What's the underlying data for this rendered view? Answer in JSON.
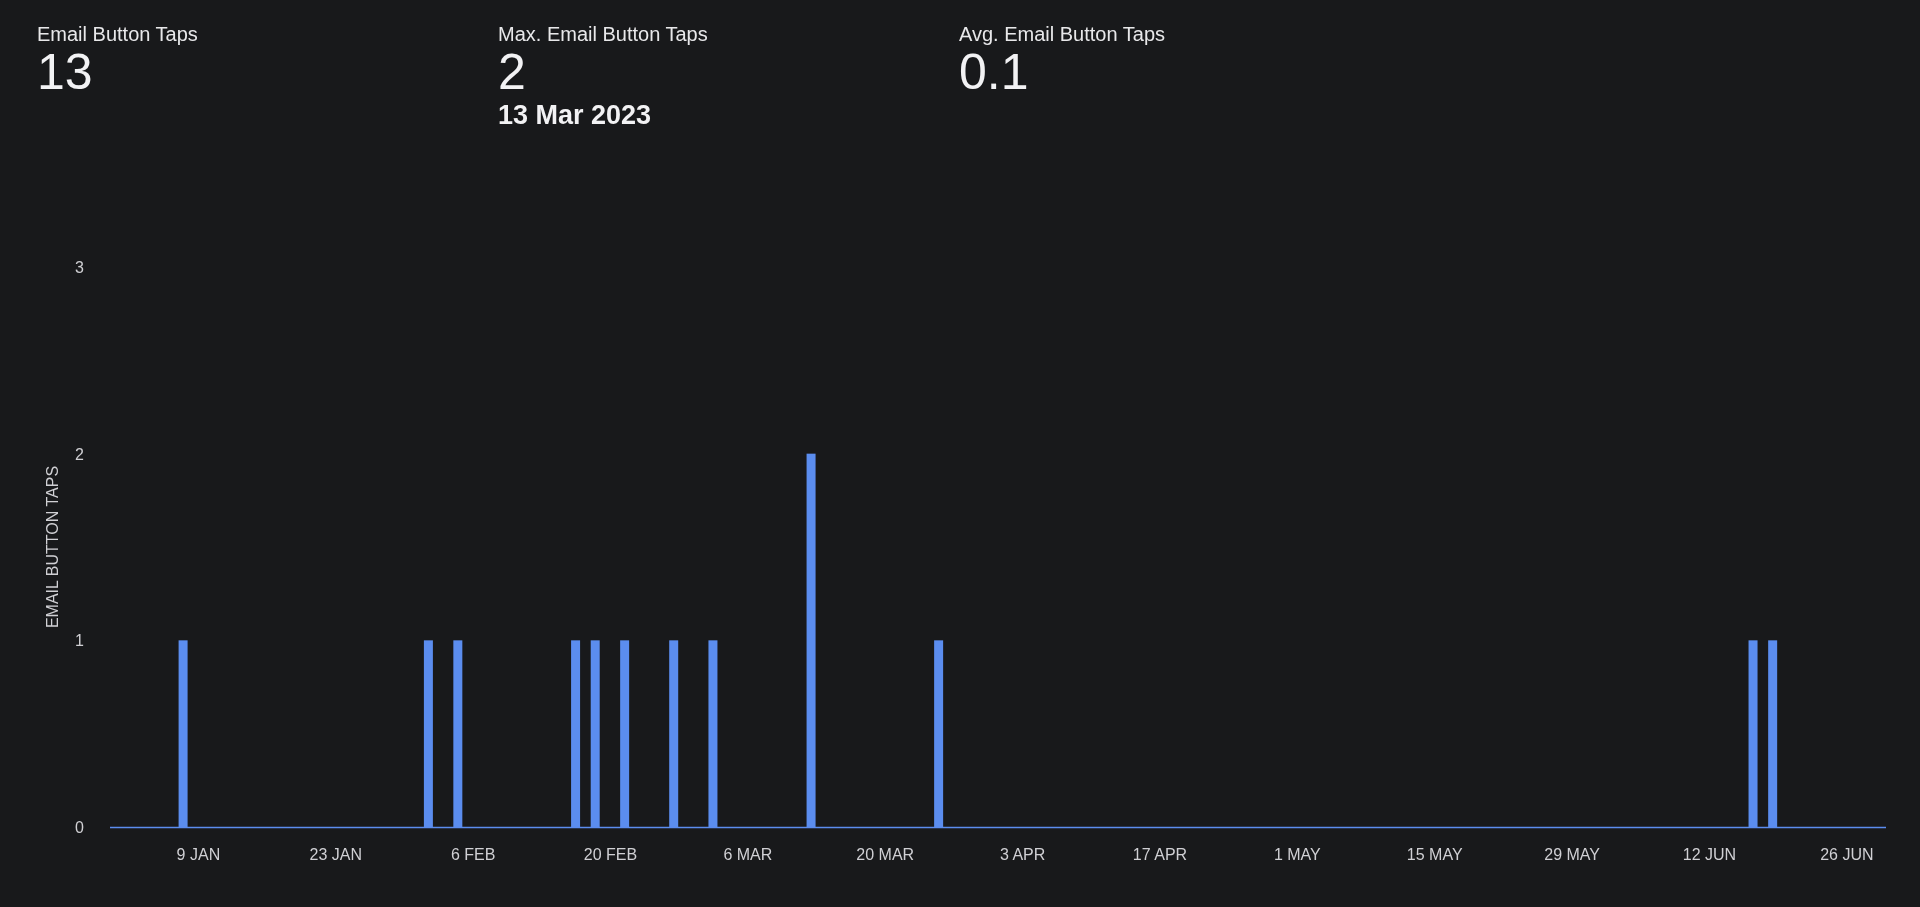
{
  "stats": [
    {
      "label": "Email Button Taps",
      "value": "13"
    },
    {
      "label": "Max. Email Button Taps",
      "value": "2",
      "date": "13 Mar 2023"
    },
    {
      "label": "Avg. Email Button Taps",
      "value": "0.1"
    }
  ],
  "chart_data": {
    "type": "bar",
    "ylabel": "EMAIL BUTTON TAPS",
    "categories": [
      null,
      null,
      null,
      null,
      null,
      null,
      null,
      null,
      "9 JAN",
      null,
      null,
      null,
      null,
      null,
      null,
      null,
      null,
      null,
      null,
      null,
      null,
      null,
      "23 JAN",
      null,
      null,
      null,
      null,
      null,
      null,
      null,
      null,
      null,
      null,
      null,
      null,
      null,
      "6 FEB",
      null,
      null,
      null,
      null,
      null,
      null,
      null,
      null,
      null,
      null,
      null,
      null,
      null,
      "20 FEB",
      null,
      null,
      null,
      null,
      null,
      null,
      null,
      null,
      null,
      null,
      null,
      null,
      null,
      "6 MAR",
      null,
      null,
      null,
      null,
      null,
      null,
      null,
      null,
      null,
      null,
      null,
      null,
      null,
      "20 MAR",
      null,
      null,
      null,
      null,
      null,
      null,
      null,
      null,
      null,
      null,
      null,
      null,
      null,
      "3 APR",
      null,
      null,
      null,
      null,
      null,
      null,
      null,
      null,
      null,
      null,
      null,
      null,
      null,
      "17 APR",
      null,
      null,
      null,
      null,
      null,
      null,
      null,
      null,
      null,
      null,
      null,
      null,
      null,
      "1 MAY",
      null,
      null,
      null,
      null,
      null,
      null,
      null,
      null,
      null,
      null,
      null,
      null,
      null,
      "15 MAY",
      null,
      null,
      null,
      null,
      null,
      null,
      null,
      null,
      null,
      null,
      null,
      null,
      null,
      "29 MAY",
      null,
      null,
      null,
      null,
      null,
      null,
      null,
      null,
      null,
      null,
      null,
      null,
      null,
      "12 JUN",
      null,
      null,
      null,
      null,
      null,
      null,
      null,
      null,
      null,
      null,
      null,
      null,
      null,
      "26 JUN",
      null,
      null,
      null,
      null
    ],
    "series": [
      {
        "color": "#5b8def",
        "values": [
          0,
          0,
          0,
          0,
          0,
          0,
          0,
          1,
          0,
          0,
          0,
          0,
          0,
          0,
          0,
          0,
          0,
          0,
          0,
          0,
          0,
          0,
          0,
          0,
          0,
          0,
          0,
          0,
          0,
          0,
          0,
          0,
          1,
          0,
          0,
          1,
          0,
          0,
          0,
          0,
          0,
          0,
          0,
          0,
          0,
          0,
          0,
          1,
          0,
          1,
          0,
          0,
          1,
          0,
          0,
          0,
          0,
          1,
          0,
          0,
          0,
          1,
          0,
          0,
          0,
          0,
          0,
          0,
          0,
          0,
          0,
          2,
          0,
          0,
          0,
          0,
          0,
          0,
          0,
          0,
          0,
          0,
          0,
          0,
          1,
          0,
          0,
          0,
          0,
          0,
          0,
          0,
          0,
          0,
          0,
          0,
          0,
          0,
          0,
          0,
          0,
          0,
          0,
          0,
          0,
          0,
          0,
          0,
          0,
          0,
          0,
          0,
          0,
          0,
          0,
          0,
          0,
          0,
          0,
          0,
          0,
          0,
          0,
          0,
          0,
          0,
          0,
          0,
          0,
          0,
          0,
          0,
          0,
          0,
          0,
          0,
          0,
          0,
          0,
          0,
          0,
          0,
          0,
          0,
          0,
          0,
          0,
          0,
          0,
          0,
          0,
          0,
          0,
          0,
          0,
          0,
          0,
          0,
          0,
          0,
          0,
          0,
          0,
          0,
          0,
          0,
          0,
          1,
          0,
          1,
          0,
          0,
          0,
          0,
          0,
          0,
          0,
          0,
          0,
          0,
          0
        ]
      }
    ],
    "ylim": [
      0,
      3
    ],
    "yticks": [
      0,
      1,
      2,
      3
    ]
  }
}
